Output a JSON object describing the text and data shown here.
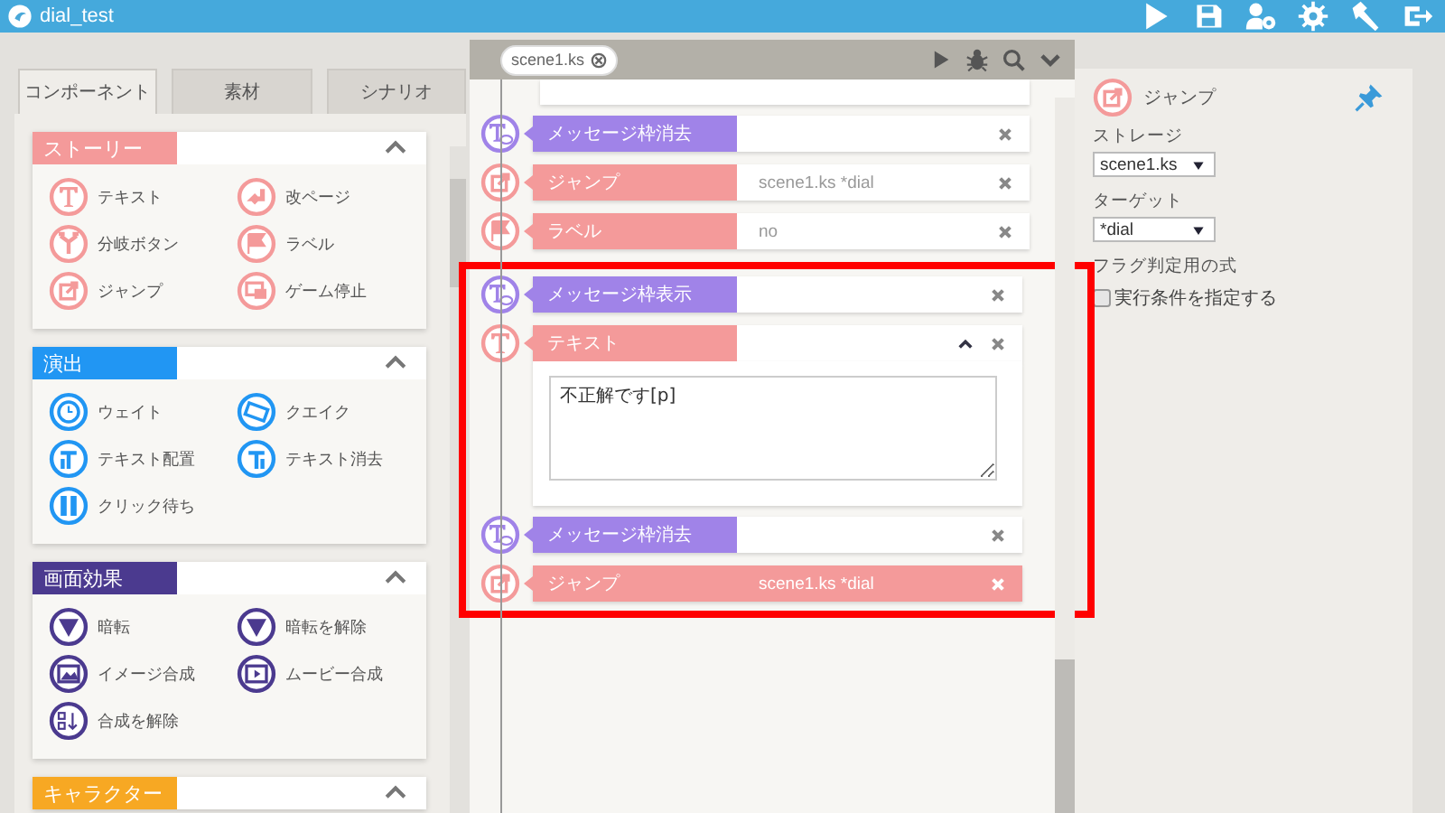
{
  "window": {
    "title": "dial_test"
  },
  "left_panel": {
    "tabs": [
      {
        "label": "コンポーネント",
        "selected": true
      },
      {
        "label": "素材",
        "selected": false
      },
      {
        "label": "シナリオ",
        "selected": false
      }
    ],
    "sections": [
      {
        "title": "ストーリー",
        "color": "#f49a9a",
        "expanded": true,
        "items": [
          {
            "label": "テキスト"
          },
          {
            "label": "改ページ"
          },
          {
            "label": "分岐ボタン"
          },
          {
            "label": "ラベル"
          },
          {
            "label": "ジャンプ"
          },
          {
            "label": "ゲーム停止"
          }
        ]
      },
      {
        "title": "演出",
        "color": "#2196f3",
        "expanded": true,
        "items": [
          {
            "label": "ウェイト"
          },
          {
            "label": "クエイク"
          },
          {
            "label": "テキスト配置"
          },
          {
            "label": "テキスト消去"
          },
          {
            "label": "クリック待ち"
          }
        ]
      },
      {
        "title": "画面効果",
        "color": "#4b3a8f",
        "expanded": true,
        "items": [
          {
            "label": "暗転"
          },
          {
            "label": "暗転を解除"
          },
          {
            "label": "イメージ合成"
          },
          {
            "label": "ムービー合成"
          },
          {
            "label": "合成を解除"
          }
        ]
      },
      {
        "title": "キャラクター",
        "color": "#f7a823",
        "expanded": true
      }
    ]
  },
  "scenario": {
    "file_tab": "scene1.ks",
    "rows": [
      {
        "label": "メッセージ枠消去",
        "color": "#a083e8",
        "selected": false,
        "highlighted": false
      },
      {
        "label": "ジャンプ",
        "value": "scene1.ks *dial",
        "color": "#f49a9a",
        "selected": false,
        "highlighted": false
      },
      {
        "label": "ラベル",
        "value": "no",
        "color": "#f49a9a",
        "selected": false,
        "highlighted": false
      },
      {
        "label": "メッセージ枠表示",
        "color": "#a083e8",
        "selected": false,
        "highlighted": true
      },
      {
        "label": "テキスト",
        "color": "#f49a9a",
        "selected": false,
        "highlighted": true,
        "expanded": true,
        "text": "不正解です[p]"
      },
      {
        "label": "メッセージ枠消去",
        "color": "#a083e8",
        "selected": false,
        "highlighted": true
      },
      {
        "label": "ジャンプ",
        "value": "scene1.ks *dial",
        "color": "#f49a9a",
        "selected": true,
        "highlighted": true
      }
    ]
  },
  "inspector": {
    "title": "ジャンプ",
    "fields": [
      {
        "kind": "select",
        "label": "ストレージ",
        "value": "scene1.ks"
      },
      {
        "kind": "select",
        "label": "ターゲット",
        "value": "*dial"
      },
      {
        "kind": "checkbox",
        "label": "フラグ判定用の式",
        "option": "実行条件を指定する",
        "checked": false
      }
    ]
  }
}
